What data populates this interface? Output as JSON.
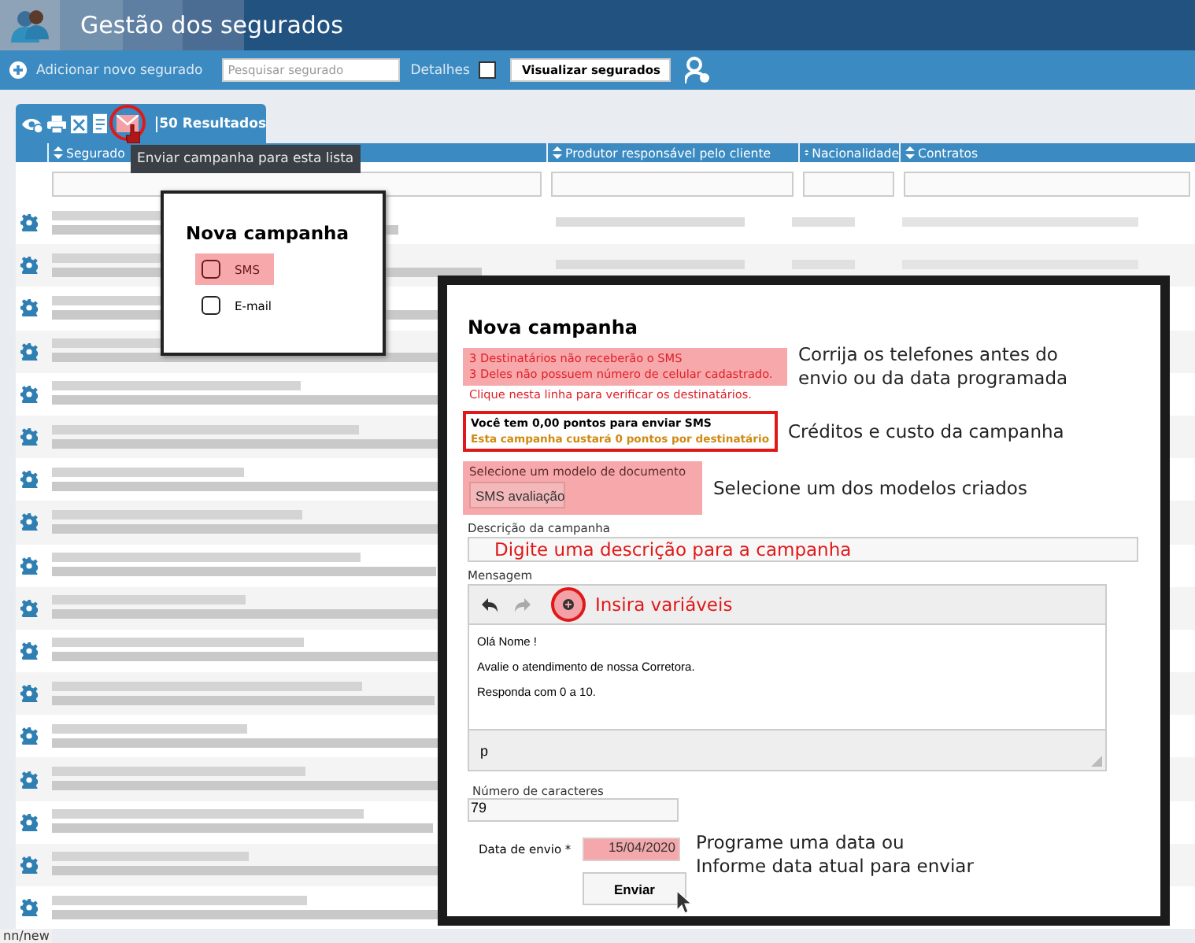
{
  "header": {
    "title": "Gestão dos segurados"
  },
  "toolbar": {
    "add_label": "Adicionar novo segurado",
    "search": {
      "placeholder": "Pesquisar segurado"
    },
    "details": {
      "label": "Detalhes",
      "checked": false
    },
    "view_button": "Visualizar segurados"
  },
  "results_tab": {
    "label": "50 Resultados"
  },
  "tooltip": "Enviar campanha para esta lista",
  "table": {
    "columns": [
      "Segurado",
      "Produtor responsável pelo cliente",
      "Nacionalidade",
      "Contratos"
    ],
    "rows": [
      {
        "kind": "redacted"
      },
      {
        "kind": "redacted"
      },
      {
        "kind": "redacted"
      },
      {
        "kind": "redacted"
      },
      {
        "kind": "redacted"
      },
      {
        "kind": "redacted"
      },
      {
        "kind": "redacted"
      },
      {
        "kind": "redacted"
      },
      {
        "kind": "redacted"
      },
      {
        "kind": "redacted"
      },
      {
        "kind": "redacted"
      },
      {
        "kind": "redacted"
      },
      {
        "kind": "redacted"
      },
      {
        "kind": "redacted"
      },
      {
        "kind": "redacted"
      },
      {
        "kind": "redacted"
      },
      {
        "kind": "redacted"
      }
    ]
  },
  "campaign_type_popup": {
    "title": "Nova campanha",
    "options": [
      {
        "label": "SMS",
        "selected": true,
        "checked": false
      },
      {
        "label": "E-mail",
        "selected": false,
        "checked": false
      }
    ]
  },
  "modal": {
    "title": "Nova campanha",
    "warnings": [
      "3 Destinatários não receberão o SMS",
      "3 Deles não possuem número de celular cadastrado."
    ],
    "warning_link": "Clique nesta linha para verificar os destinatários.",
    "warning_note": [
      "Corrija os telefones antes do",
      "envio ou da data programada"
    ],
    "credits": "Você tem 0,00 pontos para enviar SMS",
    "cost": "Esta campanha custará 0 pontos por destinatário",
    "credits_note": "Créditos e custo da campanha",
    "template": {
      "label": "Selecione um modelo de documento",
      "value": "SMS avaliação",
      "note": "Selecione um dos modelos criados"
    },
    "description": {
      "label": "Descrição da campanha",
      "note": "Digite uma descrição para a campanha"
    },
    "message": {
      "label": "Mensagem",
      "note": "Insira variáveis",
      "lines": [
        "Olá Nome !",
        "Avalie o atendimento de nossa Corretora.",
        "Responda com 0 a 10."
      ],
      "path": "p"
    },
    "char_count": {
      "label": "Número de caracteres",
      "value": "79"
    },
    "send_date": {
      "label": "Data de envio *",
      "value": "15/04/2020",
      "note": [
        "Programe uma data ou",
        "Informe data atual para enviar"
      ]
    },
    "send_button": "Enviar"
  },
  "status_url": "nn/new"
}
